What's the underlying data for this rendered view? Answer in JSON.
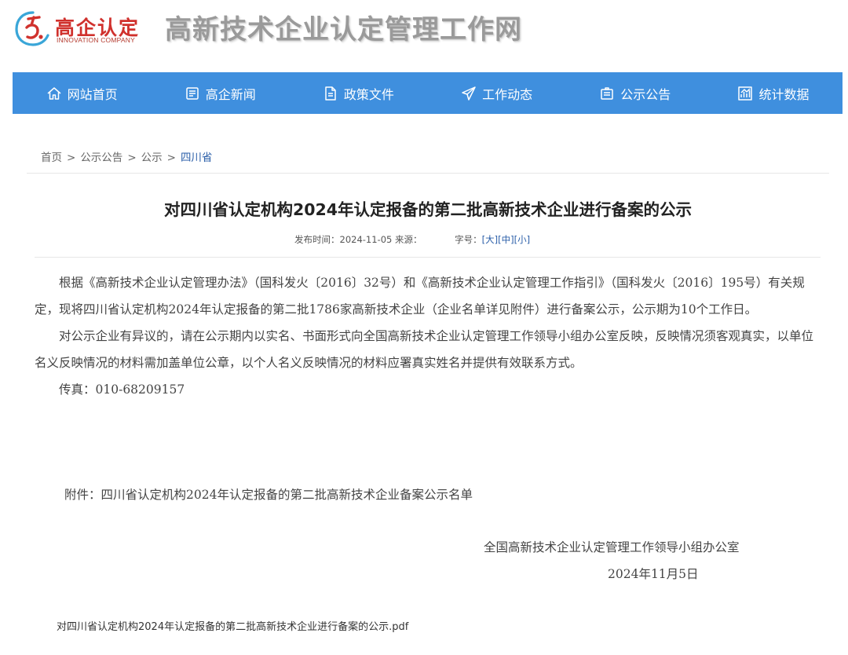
{
  "header": {
    "logo_cn": "高企认定",
    "logo_en": "INNOVATION COMPANY",
    "site_title": "高新技术企业认定管理工作网"
  },
  "nav": {
    "items": [
      {
        "label": "网站首页",
        "icon": "home-icon"
      },
      {
        "label": "高企新闻",
        "icon": "news-icon"
      },
      {
        "label": "政策文件",
        "icon": "document-icon"
      },
      {
        "label": "工作动态",
        "icon": "paper-plane-icon"
      },
      {
        "label": "公示公告",
        "icon": "announcement-icon"
      },
      {
        "label": "统计数据",
        "icon": "chart-icon"
      }
    ]
  },
  "breadcrumb": [
    "首页",
    "公示公告",
    "公示",
    "四川省"
  ],
  "article": {
    "title": "对四川省认定机构2024年认定报备的第二批高新技术企业进行备案的公示",
    "meta": {
      "publish_label": "发布时间：",
      "publish_date": "2024-11-05",
      "source_label": "来源：",
      "font_size_label": "字号：",
      "size_large": "[大]",
      "size_medium": "[中]",
      "size_small": "[小]"
    },
    "paragraphs": [
      "根据《高新技术企业认定管理办法》（国科发火〔2016〕32号）和《高新技术企业认定管理工作指引》（国科发火〔2016〕195号）有关规定，现将四川省认定机构2024年认定报备的第二批1786家高新技术企业（企业名单详见附件）进行备案公示，公示期为10个工作日。",
      "对公示企业有异议的，请在公示期内以实名、书面形式向全国高新技术企业认定管理工作领导小组办公室反映，反映情况须客观真实，以单位名义反映情况的材料需加盖单位公章，以个人名义反映情况的材料应署真实姓名并提供有效联系方式。",
      "传真：010-68209157"
    ],
    "attachment": "附件：四川省认定机构2024年认定报备的第二批高新技术企业备案公示名单",
    "signature_org": "全国高新技术企业认定管理工作领导小组办公室",
    "signature_date": "2024年11月5日",
    "pdf_link": "对四川省认定机构2024年认定报备的第二批高新技术企业进行备案的公示.pdf"
  },
  "colors": {
    "nav_bg": "#3f8fde",
    "logo_red": "#d0312d",
    "link_blue": "#2a5ea8"
  }
}
